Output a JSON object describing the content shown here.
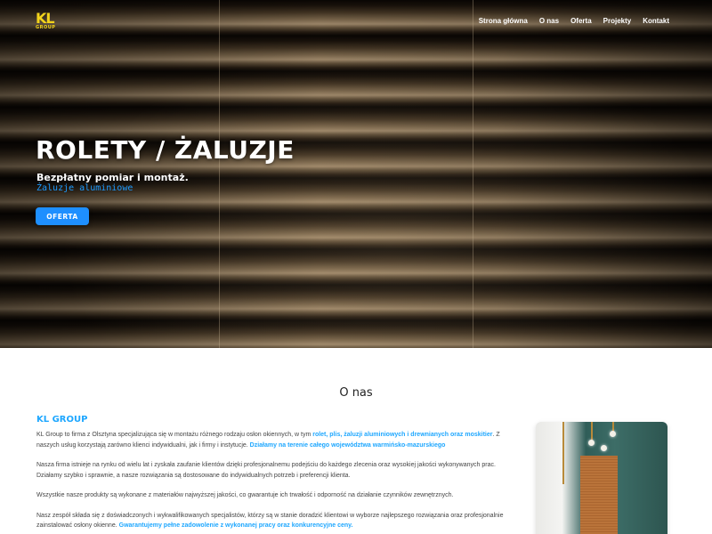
{
  "brand": {
    "logo_text": "KL",
    "logo_subtext": "GROUP"
  },
  "nav": {
    "items": [
      {
        "label": "Strona główna"
      },
      {
        "label": "O nas"
      },
      {
        "label": "Oferta"
      },
      {
        "label": "Projekty"
      },
      {
        "label": "Kontakt"
      }
    ]
  },
  "hero": {
    "title": "ROLETY / ŻALUZJE",
    "subtitle": "Bezpłatny pomiar i montaż.",
    "typed_text": "Żaluzje aluminiowe",
    "button_label": "OFERTA"
  },
  "about": {
    "title": "O nas",
    "company_name": "KL GROUP",
    "p1": {
      "a": "KL Group to firma z Olsztyna specjalizująca się w montażu różnego rodzaju osłon okiennych, w tym ",
      "b": "rolet, plis, żaluzji aluminiowych i drewnianych oraz moskitier",
      "c": ". Z naszych usług korzystają zarówno klienci indywidualni, jak i firmy i instytucje. ",
      "d": "Działamy na terenie całego województwa warmińsko-mazurskiego"
    },
    "p2": "Nasza firma istnieje na rynku od wielu lat i zyskała zaufanie klientów dzięki profesjonalnemu podejściu do każdego zlecenia oraz wysokiej jakości wykonywanych prac. Działamy szybko i sprawnie, a nasze rozwiązania są dostosowane do indywidualnych potrzeb i preferencji klienta.",
    "p3": "Wszystkie nasze produkty są wykonane z materiałów najwyższej jakości, co gwarantuje ich trwałość i odporność na działanie czynników zewnętrznych.",
    "p4": {
      "a": "Nasz zespół składa się z doświadczonych i wykwalifikowanych specjalistów, którzy są w stanie doradzić klientowi w wyborze najlepszego rozwiązania oraz profesjonalnie zainstalować osłony okienne. ",
      "b": "Gwarantujemy pełne zadowolenie z wykonanej pracy oraz konkurencyjne ceny."
    }
  },
  "colors": {
    "accent": "#1ea7ff",
    "button": "#1e8fff",
    "logo": "#f2d31b"
  }
}
